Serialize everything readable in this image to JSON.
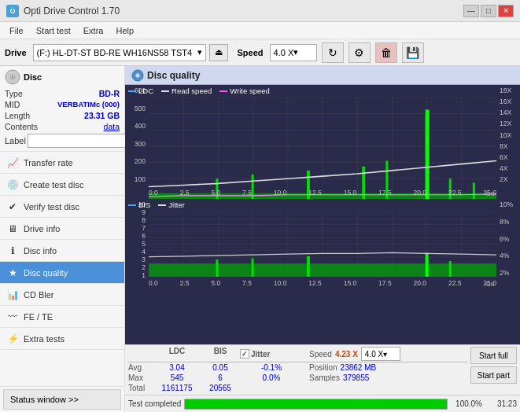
{
  "titlebar": {
    "icon": "O",
    "title": "Opti Drive Control 1.70",
    "minimize": "—",
    "maximize": "□",
    "close": "✕"
  },
  "menubar": {
    "items": [
      "File",
      "Start test",
      "Extra",
      "Help"
    ]
  },
  "drivebar": {
    "drive_label": "Drive",
    "drive_value": "(F:)  HL-DT-ST BD-RE  WH16NS58 TST4",
    "speed_label": "Speed",
    "speed_value": "4.0 X"
  },
  "disc": {
    "type_label": "Type",
    "type_value": "BD-R",
    "mid_label": "MID",
    "mid_value": "VERBATIMc (000)",
    "length_label": "Length",
    "length_value": "23.31 GB",
    "contents_label": "Contents",
    "contents_value": "data",
    "label_label": "Label",
    "label_value": ""
  },
  "nav": {
    "items": [
      {
        "id": "transfer-rate",
        "label": "Transfer rate",
        "active": false
      },
      {
        "id": "create-test-disc",
        "label": "Create test disc",
        "active": false
      },
      {
        "id": "verify-test-disc",
        "label": "Verify test disc",
        "active": false
      },
      {
        "id": "drive-info",
        "label": "Drive info",
        "active": false
      },
      {
        "id": "disc-info",
        "label": "Disc info",
        "active": false
      },
      {
        "id": "disc-quality",
        "label": "Disc quality",
        "active": true
      },
      {
        "id": "cd-bler",
        "label": "CD Bler",
        "active": false
      },
      {
        "id": "fe-te",
        "label": "FE / TE",
        "active": false
      },
      {
        "id": "extra-tests",
        "label": "Extra tests",
        "active": false
      }
    ]
  },
  "status_window_btn": "Status window >>",
  "chart": {
    "title": "Disc quality",
    "upper_legend": {
      "ldc": "LDC",
      "read_speed": "Read speed",
      "write_speed": "Write speed"
    },
    "lower_legend": {
      "bis": "BIS",
      "jitter": "Jitter"
    },
    "upper_y_left": [
      "600",
      "500",
      "400",
      "300",
      "200",
      "100"
    ],
    "upper_y_right": [
      "18X",
      "16X",
      "14X",
      "12X",
      "10X",
      "8X",
      "6X",
      "4X",
      "2X"
    ],
    "lower_y_left": [
      "10",
      "9",
      "8",
      "7",
      "6",
      "5",
      "4",
      "3",
      "2",
      "1"
    ],
    "lower_y_right": [
      "10%",
      "8%",
      "6%",
      "4%",
      "2%"
    ],
    "x_labels": [
      "0.0",
      "2.5",
      "5.0",
      "7.5",
      "10.0",
      "12.5",
      "15.0",
      "17.5",
      "20.0",
      "22.5",
      "25.0"
    ],
    "x_unit": "GB"
  },
  "stats": {
    "col_ldc": "LDC",
    "col_bis": "BIS",
    "col_jitter_label": "Jitter",
    "jitter_checked": "✓",
    "avg_label": "Avg",
    "avg_ldc": "3.04",
    "avg_bis": "0.05",
    "avg_jitter": "-0.1%",
    "max_label": "Max",
    "max_ldc": "545",
    "max_bis": "6",
    "max_jitter": "0.0%",
    "total_label": "Total",
    "total_ldc": "1161175",
    "total_bis": "20565",
    "speed_label": "Speed",
    "speed_value": "4.23 X",
    "speed_combo": "4.0 X",
    "position_label": "Position",
    "position_value": "23862 MB",
    "samples_label": "Samples",
    "samples_value": "379855",
    "btn_start_full": "Start full",
    "btn_start_part": "Start part"
  },
  "progress": {
    "bar_percent": 100,
    "bar_text": "100.0%",
    "status_text": "Test completed",
    "time_text": "31:23"
  }
}
